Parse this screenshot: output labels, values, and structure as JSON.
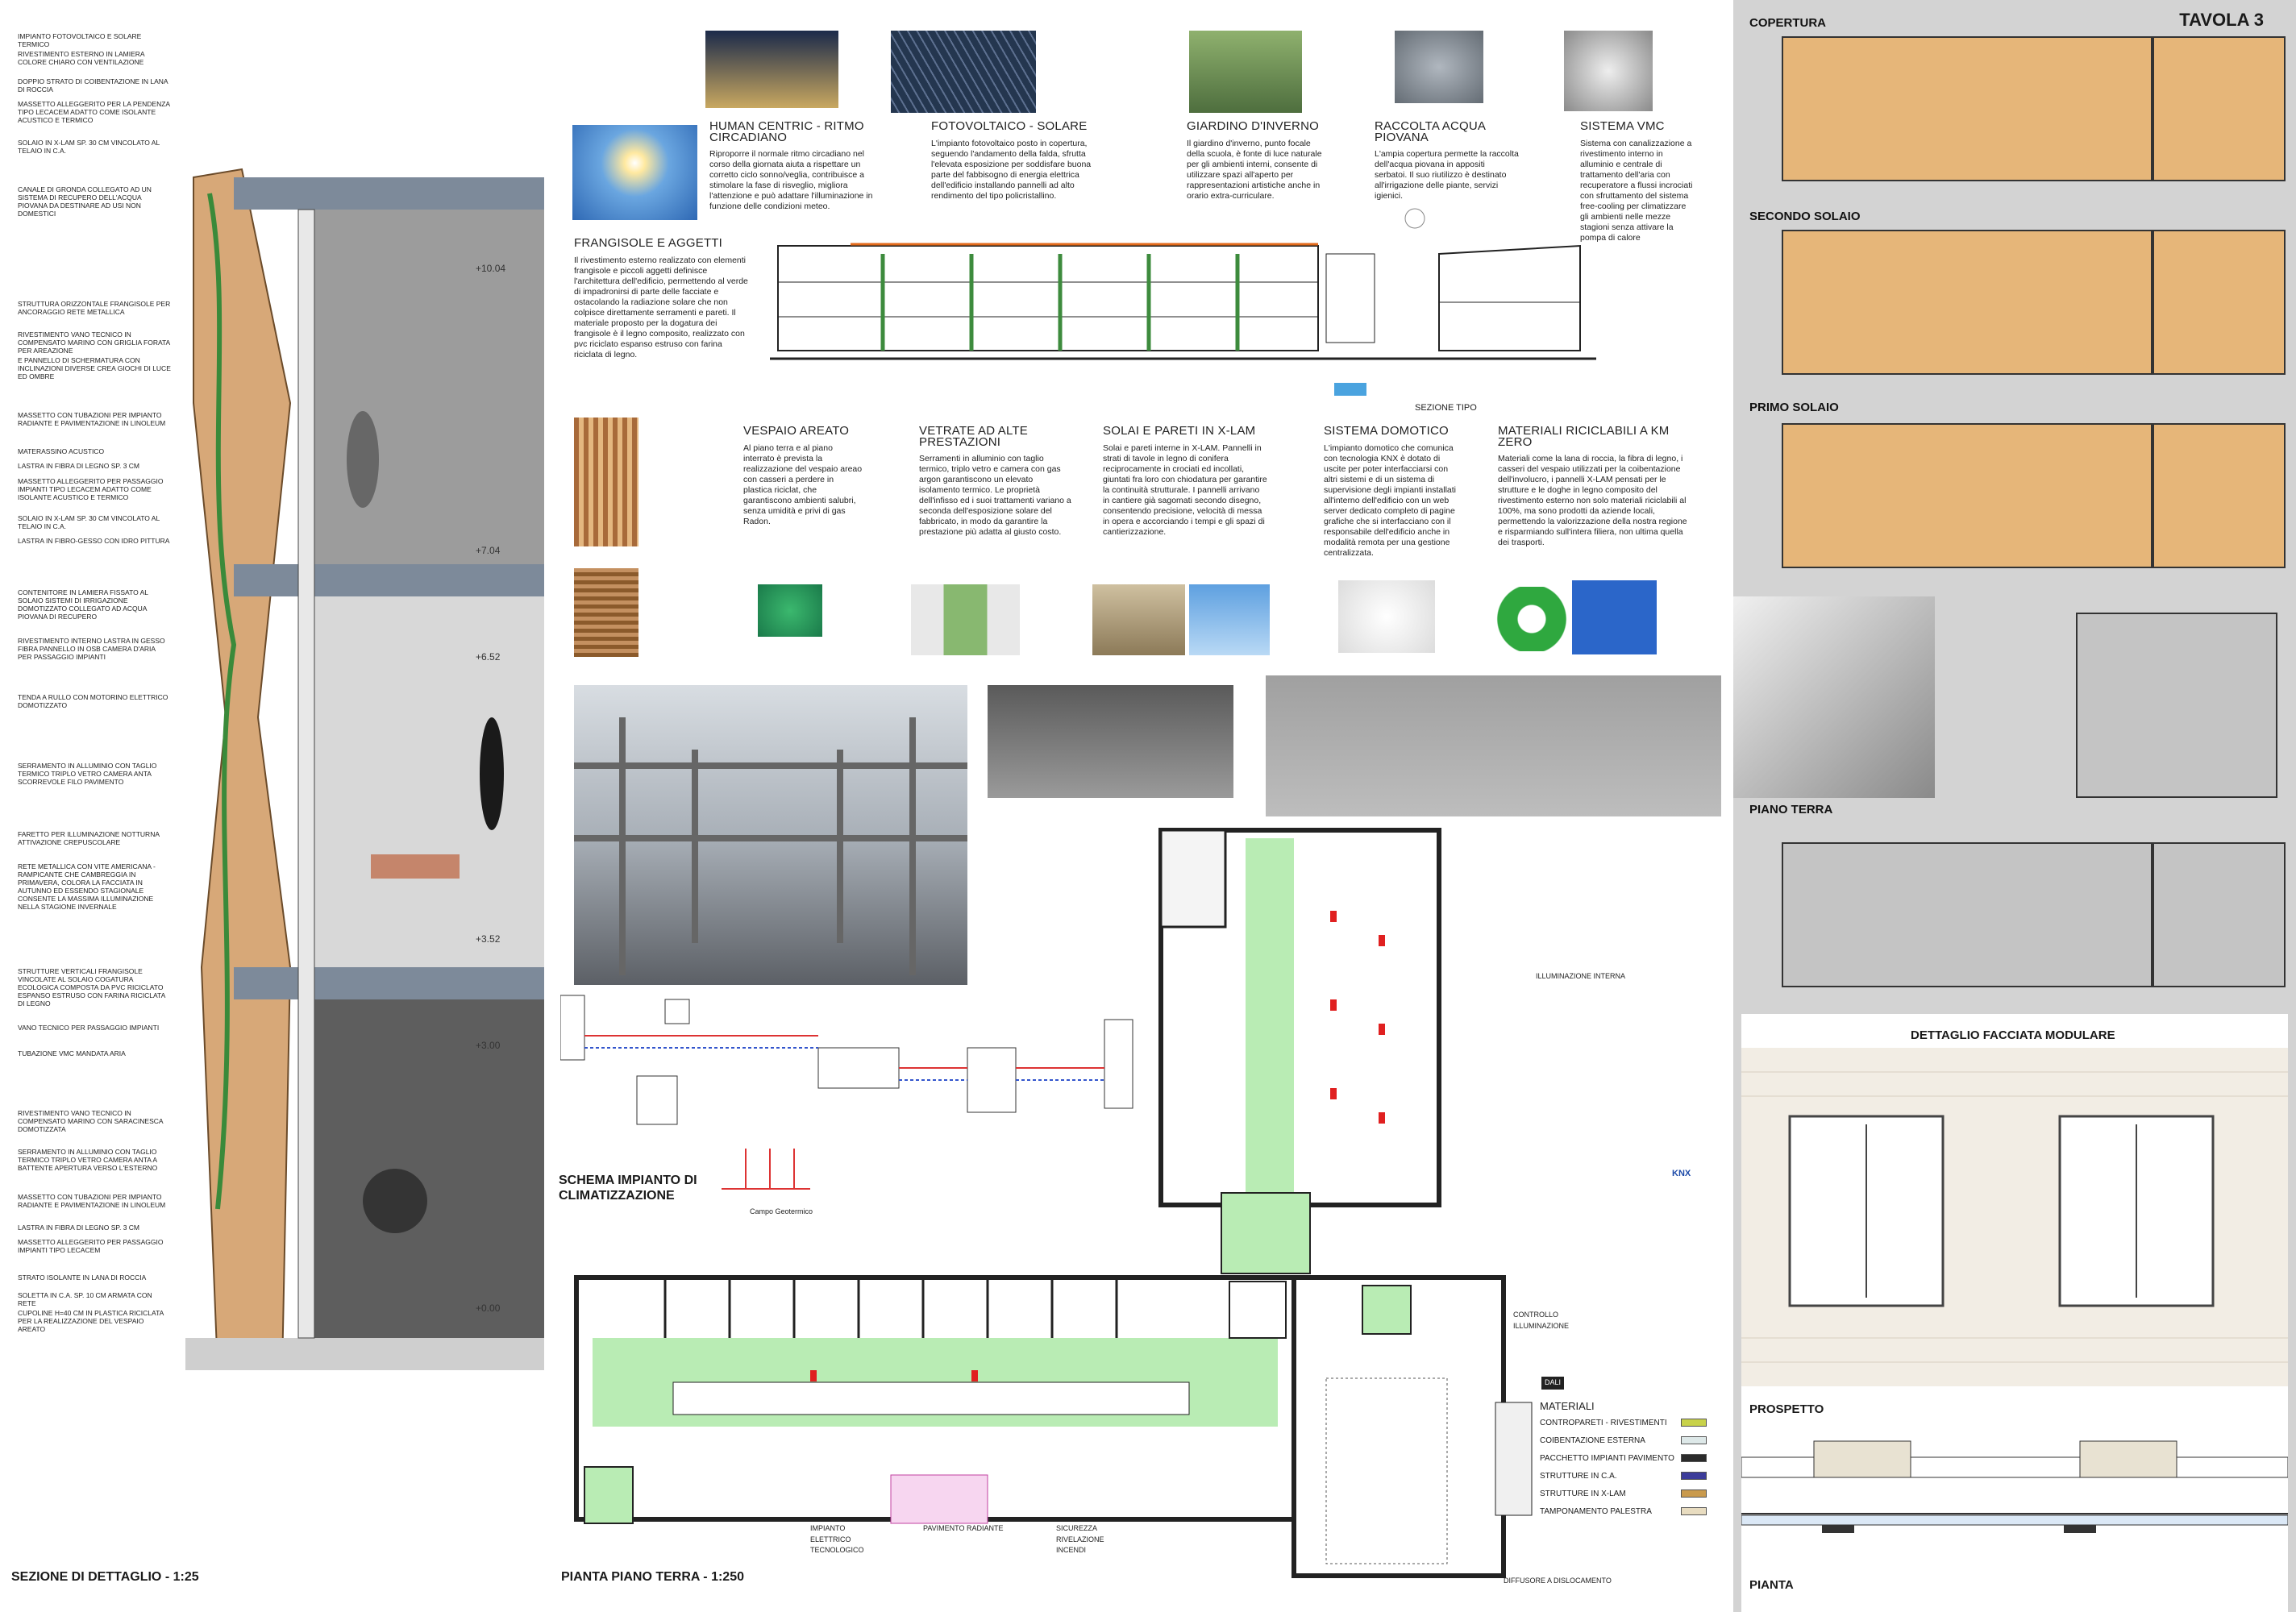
{
  "left_section": {
    "title": "SEZIONE DI DETTAGLIO - 1:25",
    "levels": [
      "+10.04",
      "+7.04",
      "+6.52",
      "+3.52",
      "+3.00",
      "+0.00"
    ],
    "labels": [
      "IMPIANTO FOTOVOLTAICO E SOLARE TERMICO",
      "RIVESTIMENTO ESTERNO IN LAMIERA COLORE CHIARO CON VENTILAZIONE",
      "DOPPIO STRATO DI COIBENTAZIONE IN LANA DI ROCCIA",
      "MASSETTO ALLEGGERITO PER LA PENDENZA TIPO LECACEM ADATTO COME ISOLANTE ACUSTICO E TERMICO",
      "SOLAIO IN X-LAM SP. 30 cm VINCOLATO AL TELAIO IN C.A.",
      "CANALE DI GRONDA COLLEGATO AD UN SISTEMA DI RECUPERO DELL'ACQUA PIOVANA DA DESTINARE AD USI NON DOMESTICI",
      "STRUTTURA ORIZZONTALE FRANGISOLE PER ANCORAGGIO RETE METALLICA",
      "RIVESTIMENTO VANO TECNICO IN COMPENSATO MARINO CON GRIGLIA FORATA PER AREAZIONE",
      "E PANNELLO DI SCHERMATURA CON INCLINAZIONI DIVERSE CREA GIOCHI DI LUCE ED OMBRE",
      "MASSETTO CON TUBAZIONI PER IMPIANTO RADIANTE E PAVIMENTAZIONE IN LINOLEUM",
      "MATERASSINO ACUSTICO",
      "LASTRA IN FIBRA DI LEGNO SP. 3 cm",
      "MASSETTO ALLEGGERITO PER PASSAGGIO IMPIANTI TIPO LECACEM ADATTO COME ISOLANTE ACUSTICO E TERMICO",
      "SOLAIO IN X-LAM SP. 30 cm VINCOLATO AL TELAIO IN C.A.",
      "LASTRA IN FIBRO-GESSO CON IDRO PITTURA",
      "CONTENITORE IN LAMIERA FISSATO AL SOLAIO SISTEMI DI IRRIGAZIONE DOMOTIZZATO COLLEGATO AD ACQUA PIOVANA DI RECUPERO",
      "RIVESTIMENTO INTERNO LASTRA IN GESSO FIBRA PANNELLO IN OSB CAMERA D'ARIA PER PASSAGGIO IMPIANTI",
      "TENDA A RULLO CON MOTORINO ELETTRICO DOMOTIZZATO",
      "SERRAMENTO IN ALLUMINIO CON TAGLIO TERMICO TRIPLO VETRO CAMERA ANTA SCORREVOLE FILO PAVIMENTO",
      "FARETTO PER ILLUMINAZIONE NOTTURNA ATTIVAZIONE CREPUSCOLARE",
      "RETE METALLICA CON VITE AMERICANA - RAMPICANTE CHE CAMBREGGIA IN PRIMAVERA, COLORA LA FACCIATA IN AUTUNNO ED ESSENDO STAGIONALE CONSENTE LA MASSIMA ILLUMINAZIONE NELLA STAGIONE INVERNALE",
      "STRUTTURE VERTICALI FRANGISOLE VINCOLATE AL SOLAIO COGATURA ECOLOGICA COMPOSTA DA PVC RICICLATO ESPANSO ESTRUSO CON FARINA RICICLATA DI LEGNO",
      "VANO TECNICO PER PASSAGGIO IMPIANTI",
      "TUBAZIONE VMC MANDATA ARIA",
      "RIVESTIMENTO VANO TECNICO IN COMPENSATO MARINO CON SARACINESCA DOMOTIZZATA",
      "SERRAMENTO IN ALLUMINIO CON TAGLIO TERMICO TRIPLO VETRO CAMERA ANTA A BATTENTE APERTURA VERSO L'ESTERNO",
      "MASSETTO CON TUBAZIONI PER IMPIANTO RADIANTE E PAVIMENTAZIONE IN LINOLEUM",
      "LASTRA IN FIBRA DI LEGNO SP. 3 cm",
      "MASSETTO ALLEGGERITO PER PASSAGGIO IMPIANTI TIPO LECACEM",
      "STRATO ISOLANTE IN LANA DI ROCCIA",
      "SOLETTA IN C.A. SP. 10 cm ARMATA CON RETE",
      "CUPOLINE h=40 cm IN PLASTICA RICICLATA PER LA REALIZZAZIONE DEL VESPAIO AREATO"
    ]
  },
  "concepts": {
    "human_centric": {
      "title": "HUMAN CENTRIC - RITMO CIRCADIANO",
      "body": "Riproporre il normale ritmo circadiano nel corso della giornata aiuta a rispettare un corretto ciclo sonno/veglia, contribuisce a stimolare la fase di risveglio, migliora l'attenzione e può adattare l'illuminazione in funzione delle condizioni meteo."
    },
    "fotovoltaico": {
      "title": "FOTOVOLTAICO - SOLARE",
      "body": "L'impianto fotovoltaico posto in copertura, seguendo l'andamento della falda, sfrutta l'elevata esposizione per soddisfare buona parte del fabbisogno di energia elettrica dell'edificio installando pannelli ad alto rendimento del tipo policristallino."
    },
    "giardino": {
      "title": "GIARDINO D'INVERNO",
      "body": "Il giardino d'inverno, punto focale della scuola, è fonte di luce naturale per gli ambienti interni, consente di utilizzare spazi all'aperto per rappresentazioni artistiche anche in orario extra-curriculare."
    },
    "acqua": {
      "title": "RACCOLTA ACQUA PIOVANA",
      "body": "L'ampia copertura permette la raccolta dell'acqua piovana in appositi serbatoi. Il suo riutilizzo è destinato all'irrigazione delle piante, servizi igienici."
    },
    "vmc": {
      "title": "SISTEMA VMC",
      "body": "Sistema con canalizzazione a rivestimento interno in alluminio e centrale di trattamento dell'aria con recuperatore a flussi incrociati con sfruttamento del sistema free-cooling per climatizzare gli ambienti nelle mezze stagioni senza attivare la pompa di calore"
    },
    "frangisole": {
      "title": "FRANGISOLE E AGGETTI",
      "body": "Il rivestimento esterno realizzato con elementi frangisole e piccoli aggetti definisce l'architettura dell'edificio, permettendo al verde di impadronirsi di parte delle facciate e ostacolando la radiazione solare che non colpisce direttamente serramenti e pareti. Il materiale proposto per la dogatura dei frangisole è il legno composito, realizzato con pvc riciclato espanso estruso con farina riciclata di legno."
    },
    "vespaio": {
      "title": "VESPAIO AREATO",
      "body": "Al piano terra e al piano interrato è prevista la realizzazione del vespaio areao con casseri a perdere in plastica riciclat, che garantiscono ambienti salubri, senza umidità e privi di gas Radon."
    },
    "vetrate": {
      "title": "VETRATE AD ALTE PRESTAZIONI",
      "body": "Serramenti in alluminio con taglio termico, triplo vetro e camera con gas argon garantiscono un elevato isolamento termico. Le proprietà dell'infisso ed i suoi trattamenti variano a seconda dell'esposizione solare del fabbricato, in modo da garantire la prestazione più adatta al giusto costo."
    },
    "solai": {
      "title": "SOLAI E PARETI IN X-LAM",
      "body": "Solai e pareti interne in X-LAM. Pannelli in strati di tavole in legno di conifera reciprocamente in crociati ed incollati, giuntati fra loro con chiodatura per garantire la continuità strutturale. I pannelli arrivano in cantiere già sagomati secondo disegno, consentendo precisione, velocità di messa in opera e accorciando i tempi e gli spazi di cantierizzazione."
    },
    "domotico": {
      "title": "SISTEMA DOMOTICO",
      "body": "L'impianto domotico che comunica con tecnologia KNX è dotato di uscite per poter interfacciarsi con altri sistemi e di un sistema di supervisione degli impianti installati all'interno dell'edificio con un web server dedicato completo di pagine grafiche che si interfacciano con il responsabile dell'edificio anche in modalità remota per una gestione centralizzata."
    },
    "materiali": {
      "title": "MATERIALI RICICLABILI a Km ZERO",
      "body": "Materiali come la lana di roccia, la fibra di legno, i casseri del vespaio utilizzati per la coibentazione dell'involucro, i pannelli X-LAM pensati per le strutture e le doghe in legno composito del rivestimento esterno non solo materiali riciclabili al 100%, ma sono prodotti da aziende locali, permettendo la valorizzazione della nostra regione e risparmiando sull'intera filiera, non ultima quella dei trasporti."
    }
  },
  "middle": {
    "sezione_tipo": "SEZIONE TIPO",
    "schema_title": "SCHEMA IMPIANTO DI CLIMATIZZAZIONE",
    "campo": "Campo Geotermico",
    "pianta_title": "PIANTA PIANO TERRA - 1:250",
    "illuminazione_interna": "ILLUMINAZIONE INTERNA",
    "controllo": "CONTROLLO ILLUMINAZIONE",
    "diffusore": "DIFFUSORE A DISLOCAMENTO",
    "plan_notes": [
      "IMPIANTO ELETTRICO TECNOLOGICO",
      "PAVIMENTO RADIANTE",
      "SICUREZZA RIVELAZIONE INCENDI"
    ],
    "knx": "KNX",
    "dali": "DALI",
    "materiali_title": "MATERIALI",
    "materiali_legend": [
      {
        "label": "CONTROPARETI - RIVESTIMENTI",
        "color": "#c8d24a"
      },
      {
        "label": "COIBENTAZIONE ESTERNA",
        "color": "#dde8e8"
      },
      {
        "label": "PACCHETTO IMPIANTI PAVIMENTO",
        "color": "#2b2b2b"
      },
      {
        "label": "STRUTTURE IN C.A.",
        "color": "#3c3c9a"
      },
      {
        "label": "STRUTTURE IN X-LAM",
        "color": "#c99a4d"
      },
      {
        "label": "TAMPONAMENTO PALESTRA",
        "color": "#e8dcc0"
      }
    ]
  },
  "right": {
    "tavola": "TAVOLA 3",
    "copertura": "COPERTURA",
    "secondo_solaio": "SECONDO SOLAIO",
    "primo_solaio": "PRIMO SOLAIO",
    "piano_terra": "PIANO TERRA",
    "dettaglio": "DETTAGLIO FACCIATA MODULARE",
    "prospetto": "PROSPETTO",
    "pianta": "PIANTA"
  },
  "colors": {
    "xlam": "#e6b679",
    "plan_bg": "#d3d3d3",
    "corridor": "#b9ecb4"
  }
}
